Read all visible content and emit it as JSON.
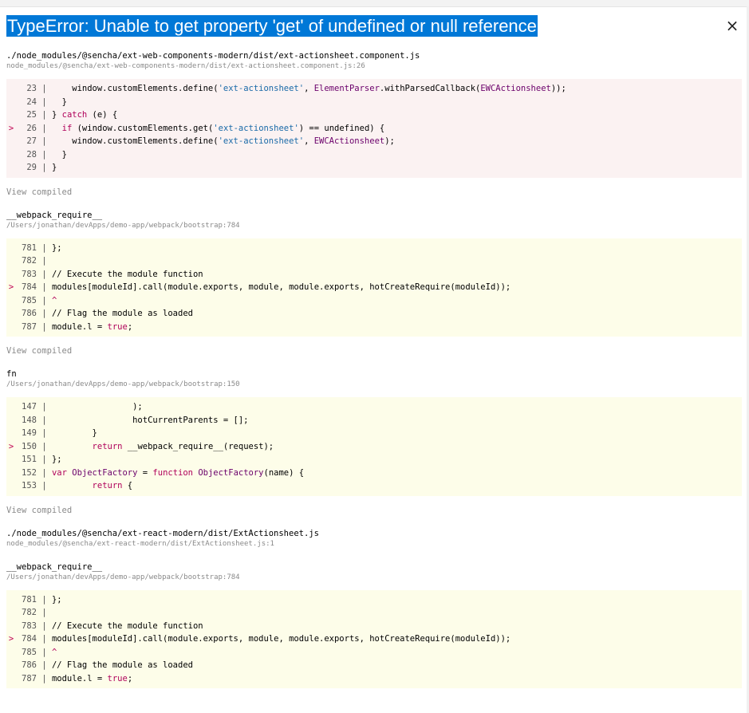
{
  "error": {
    "title": "TypeError: Unable to get property 'get' of undefined or null reference",
    "close_label": "×"
  },
  "frames": [
    {
      "fn": "./node_modules/@sencha/ext-web-components-modern/dist/ext-actionsheet.component.js",
      "path": "node_modules/@sencha/ext-web-components-modern/dist/ext-actionsheet.component.js:26",
      "style": "app",
      "view_compiled": "View compiled",
      "lines": [
        {
          "n": "23",
          "hl": false,
          "tokens": [
            [
              "p",
              "    window.customElements.define("
            ],
            [
              "s",
              "'ext-actionsheet'"
            ],
            [
              "p",
              ", "
            ],
            [
              "i",
              "ElementParser"
            ],
            [
              "p",
              ".withParsedCallback("
            ],
            [
              "i",
              "EWCActionsheet"
            ],
            [
              "p",
              "));"
            ]
          ]
        },
        {
          "n": "24",
          "hl": false,
          "tokens": [
            [
              "p",
              "  }"
            ]
          ]
        },
        {
          "n": "25",
          "hl": false,
          "tokens": [
            [
              "p",
              "} "
            ],
            [
              "k",
              "catch"
            ],
            [
              "p",
              " (e) {"
            ]
          ]
        },
        {
          "n": "26",
          "hl": true,
          "tokens": [
            [
              "p",
              "  "
            ],
            [
              "k",
              "if"
            ],
            [
              "p",
              " (window.customElements.get("
            ],
            [
              "s",
              "'ext-actionsheet'"
            ],
            [
              "p",
              ") == undefined) {"
            ]
          ]
        },
        {
          "n": "27",
          "hl": false,
          "tokens": [
            [
              "p",
              "    window.customElements.define("
            ],
            [
              "s",
              "'ext-actionsheet'"
            ],
            [
              "p",
              ", "
            ],
            [
              "i",
              "EWCActionsheet"
            ],
            [
              "p",
              ");"
            ]
          ]
        },
        {
          "n": "28",
          "hl": false,
          "tokens": [
            [
              "p",
              "  }"
            ]
          ]
        },
        {
          "n": "29",
          "hl": false,
          "tokens": [
            [
              "p",
              "}"
            ]
          ]
        }
      ]
    },
    {
      "fn": "__webpack_require__",
      "path": "/Users/jonathan/devApps/demo-app/webpack/bootstrap:784",
      "style": "lib",
      "view_compiled": "View compiled",
      "lines": [
        {
          "n": "781",
          "hl": false,
          "tokens": [
            [
              "p",
              "};"
            ]
          ]
        },
        {
          "n": "782",
          "hl": false,
          "tokens": [
            [
              "p",
              ""
            ]
          ]
        },
        {
          "n": "783",
          "hl": false,
          "tokens": [
            [
              "p",
              "// Execute the module function"
            ]
          ]
        },
        {
          "n": "784",
          "hl": true,
          "tokens": [
            [
              "p",
              "modules[moduleId].call(module.exports, module, module.exports, hotCreateRequire(moduleId));"
            ]
          ]
        },
        {
          "n": "785",
          "hl": false,
          "tokens": [
            [
              "k",
              "^"
            ]
          ]
        },
        {
          "n": "786",
          "hl": false,
          "tokens": [
            [
              "p",
              "// Flag the module as loaded"
            ]
          ]
        },
        {
          "n": "787",
          "hl": false,
          "tokens": [
            [
              "p",
              "module.l = "
            ],
            [
              "k",
              "true"
            ],
            [
              "p",
              ";"
            ]
          ]
        }
      ]
    },
    {
      "fn": "fn",
      "path": "/Users/jonathan/devApps/demo-app/webpack/bootstrap:150",
      "style": "lib",
      "view_compiled": "View compiled",
      "lines": [
        {
          "n": "147",
          "hl": false,
          "tokens": [
            [
              "p",
              "                );"
            ]
          ]
        },
        {
          "n": "148",
          "hl": false,
          "tokens": [
            [
              "p",
              "                hotCurrentParents = [];"
            ]
          ]
        },
        {
          "n": "149",
          "hl": false,
          "tokens": [
            [
              "p",
              "        }"
            ]
          ]
        },
        {
          "n": "150",
          "hl": true,
          "tokens": [
            [
              "p",
              "        "
            ],
            [
              "k",
              "return"
            ],
            [
              "p",
              " __webpack_require__(request);"
            ]
          ]
        },
        {
          "n": "151",
          "hl": false,
          "tokens": [
            [
              "p",
              "};"
            ]
          ]
        },
        {
          "n": "152",
          "hl": false,
          "tokens": [
            [
              "k",
              "var"
            ],
            [
              "p",
              " "
            ],
            [
              "i",
              "ObjectFactory"
            ],
            [
              "p",
              " = "
            ],
            [
              "k",
              "function"
            ],
            [
              "p",
              " "
            ],
            [
              "i",
              "ObjectFactory"
            ],
            [
              "p",
              "(name) {"
            ]
          ]
        },
        {
          "n": "153",
          "hl": false,
          "tokens": [
            [
              "p",
              "        "
            ],
            [
              "k",
              "return"
            ],
            [
              "p",
              " {"
            ]
          ]
        }
      ]
    },
    {
      "fn": "./node_modules/@sencha/ext-react-modern/dist/ExtActionsheet.js",
      "path": "node_modules/@sencha/ext-react-modern/dist/ExtActionsheet.js:1",
      "style": "none",
      "lines": []
    },
    {
      "fn": "__webpack_require__",
      "path": "/Users/jonathan/devApps/demo-app/webpack/bootstrap:784",
      "style": "lib",
      "lines": [
        {
          "n": "781",
          "hl": false,
          "tokens": [
            [
              "p",
              "};"
            ]
          ]
        },
        {
          "n": "782",
          "hl": false,
          "tokens": [
            [
              "p",
              ""
            ]
          ]
        },
        {
          "n": "783",
          "hl": false,
          "tokens": [
            [
              "p",
              "// Execute the module function"
            ]
          ]
        },
        {
          "n": "784",
          "hl": true,
          "tokens": [
            [
              "p",
              "modules[moduleId].call(module.exports, module, module.exports, hotCreateRequire(moduleId));"
            ]
          ]
        },
        {
          "n": "785",
          "hl": false,
          "tokens": [
            [
              "k",
              "^"
            ]
          ]
        },
        {
          "n": "786",
          "hl": false,
          "tokens": [
            [
              "p",
              "// Flag the module as loaded"
            ]
          ]
        },
        {
          "n": "787",
          "hl": false,
          "tokens": [
            [
              "p",
              "module.l = "
            ],
            [
              "k",
              "true"
            ],
            [
              "p",
              ";"
            ]
          ]
        }
      ]
    }
  ]
}
